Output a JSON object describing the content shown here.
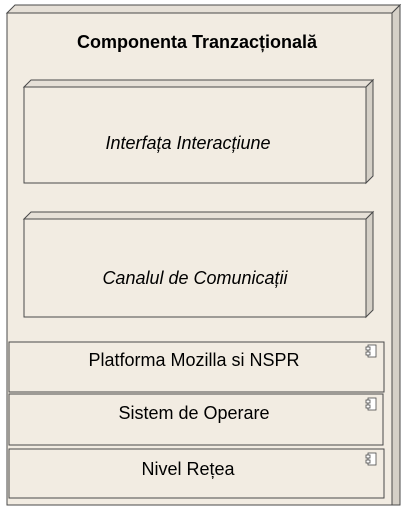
{
  "diagram": {
    "title": "Componenta Tranzacțională",
    "inner_nodes": [
      {
        "label": "Interfața Interacțiune"
      },
      {
        "label": "Canalul de Comunicații"
      }
    ],
    "layers": [
      {
        "label": "Platforma Mozilla si NSPR",
        "icon": "component-icon"
      },
      {
        "label": "Sistem de Operare",
        "icon": "component-icon"
      },
      {
        "label": "Nivel Rețea",
        "icon": "component-icon"
      }
    ]
  },
  "colors": {
    "fill": "#f2ece2",
    "outline": "#4a4a4a",
    "text": "#000000"
  }
}
